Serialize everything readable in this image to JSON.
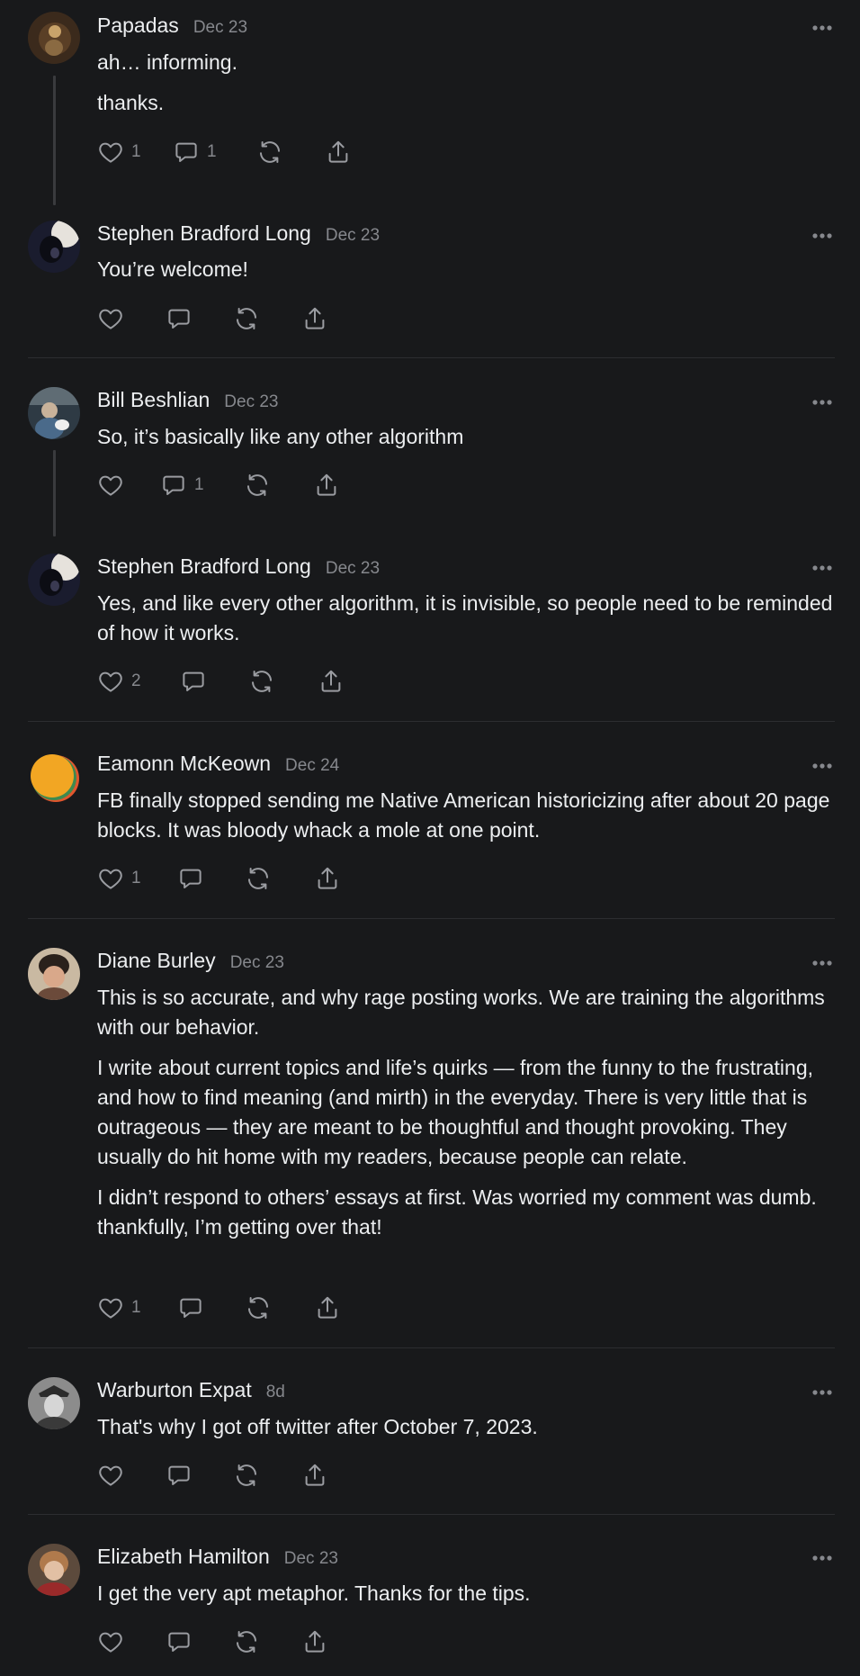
{
  "comments": [
    {
      "author": "Papadas",
      "date": "Dec 23",
      "paragraphs": [
        "ah… informing.",
        "thanks."
      ],
      "likes": "1",
      "replies": "1"
    },
    {
      "author": "Stephen Bradford Long",
      "date": "Dec 23",
      "paragraphs": [
        "You’re welcome!"
      ],
      "likes": "",
      "replies": ""
    },
    {
      "author": "Bill Beshlian",
      "date": "Dec 23",
      "paragraphs": [
        "So, it’s basically like any other algorithm"
      ],
      "likes": "",
      "replies": "1"
    },
    {
      "author": "Stephen Bradford Long",
      "date": "Dec 23",
      "paragraphs": [
        "Yes, and like every other algorithm, it is invisible, so people need to be reminded of how it works."
      ],
      "likes": "2",
      "replies": ""
    },
    {
      "author": "Eamonn McKeown",
      "date": "Dec 24",
      "paragraphs": [
        "FB finally stopped sending me Native American historicizing after about 20 page blocks. It was bloody whack a mole at one point."
      ],
      "likes": "1",
      "replies": ""
    },
    {
      "author": "Diane Burley",
      "date": "Dec 23",
      "paragraphs": [
        "This is so accurate, and why rage posting works. We are training the algorithms with our behavior.",
        "I write about current topics and life’s quirks — from the funny to the frustrating, and how to find meaning (and mirth) in the everyday. There is very little that is outrageous — they are meant to be thoughtful and thought provoking. They usually do hit home with my readers, because people can relate.",
        "I didn’t respond to others’ essays at first. Was worried my comment was dumb. thankfully, I’m getting over that!"
      ],
      "likes": "1",
      "replies": ""
    },
    {
      "author": "Warburton Expat",
      "date": "8d",
      "paragraphs": [
        "That's why I got off twitter after October 7, 2023."
      ],
      "likes": "",
      "replies": ""
    },
    {
      "author": "Elizabeth Hamilton",
      "date": "Dec 23",
      "paragraphs": [
        "I get the very apt metaphor. Thanks for the tips."
      ],
      "likes": "",
      "replies": ""
    }
  ],
  "icons": {
    "like": "heart-icon",
    "reply": "comment-bubble-icon",
    "restack": "restack-icon",
    "share": "share-icon",
    "more": "ellipsis-icon"
  },
  "colors": {
    "background": "#18191b",
    "text": "#eceef0",
    "muted": "#86888d",
    "icon": "#9a9ca1",
    "divider": "#2c2d30",
    "thread_line": "#3a3b3e"
  }
}
